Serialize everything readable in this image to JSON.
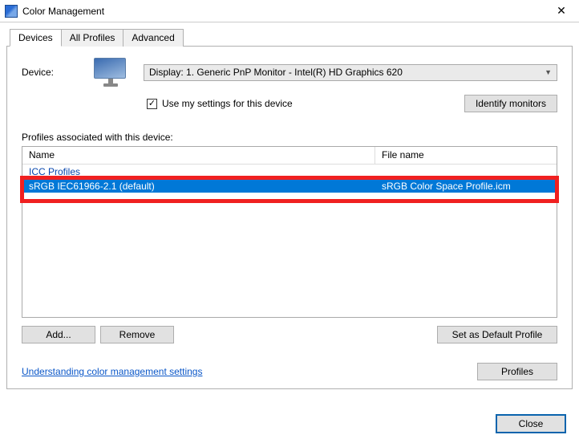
{
  "window": {
    "title": "Color Management",
    "close_glyph": "✕"
  },
  "tabs": {
    "devices": "Devices",
    "all_profiles": "All Profiles",
    "advanced": "Advanced"
  },
  "device": {
    "label": "Device:",
    "selected": "Display: 1. Generic PnP Monitor - Intel(R) HD Graphics 620",
    "use_my_settings_label": "Use my settings for this device",
    "use_my_settings_checked": "✓",
    "identify_button": "Identify monitors"
  },
  "profiles": {
    "section_label": "Profiles associated with this device:",
    "columns": {
      "name": "Name",
      "file": "File name"
    },
    "group_label": "ICC Profiles",
    "selected": {
      "name": "sRGB IEC61966-2.1 (default)",
      "file": "sRGB Color Space Profile.icm"
    }
  },
  "buttons": {
    "add": "Add...",
    "remove": "Remove",
    "set_default": "Set as Default Profile",
    "profiles": "Profiles",
    "close": "Close"
  },
  "link": {
    "understanding": "Understanding color management settings"
  }
}
